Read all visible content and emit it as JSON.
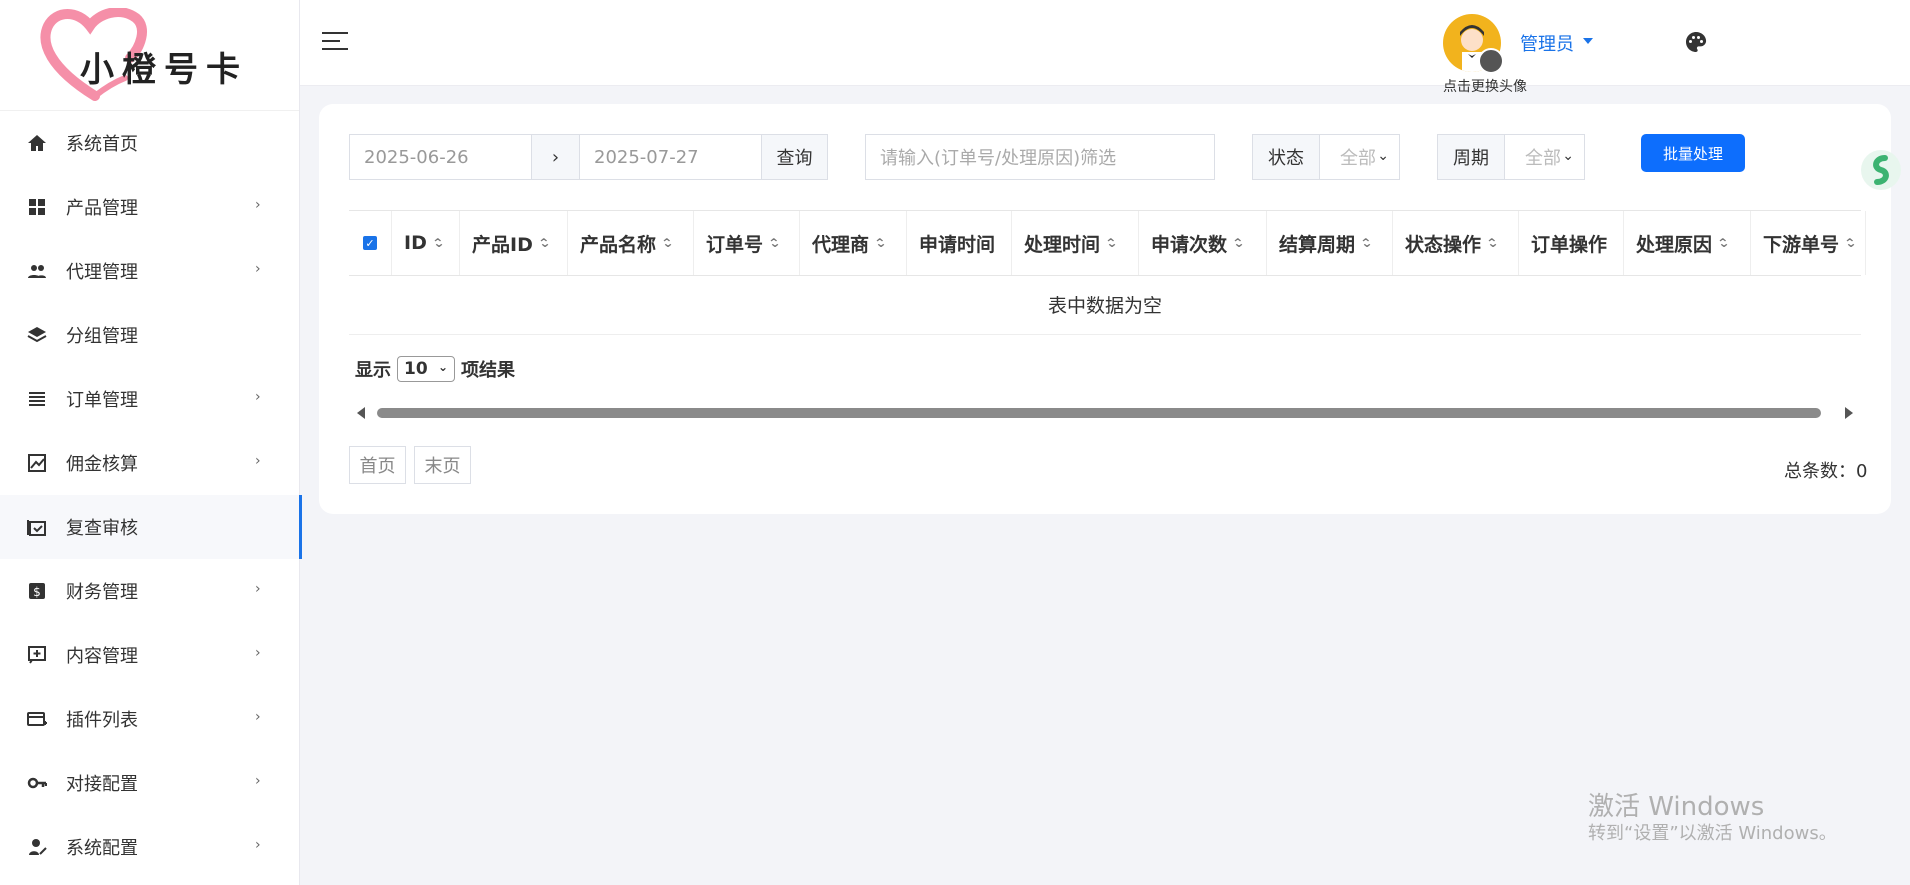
{
  "brand": {
    "logo_text": "小橙号卡"
  },
  "sidebar": {
    "items": [
      {
        "label": "系统首页",
        "icon": "home-icon",
        "has_submenu": false,
        "active": false
      },
      {
        "label": "产品管理",
        "icon": "grid-icon",
        "has_submenu": true,
        "active": false
      },
      {
        "label": "代理管理",
        "icon": "people-icon",
        "has_submenu": true,
        "active": false
      },
      {
        "label": "分组管理",
        "icon": "layers-icon",
        "has_submenu": false,
        "active": false
      },
      {
        "label": "订单管理",
        "icon": "list-icon",
        "has_submenu": true,
        "active": false
      },
      {
        "label": "佣金核算",
        "icon": "chart-icon",
        "has_submenu": true,
        "active": false
      },
      {
        "label": "复查审核",
        "icon": "review-icon",
        "has_submenu": false,
        "active": true
      },
      {
        "label": "财务管理",
        "icon": "dollar-icon",
        "has_submenu": true,
        "active": false
      },
      {
        "label": "内容管理",
        "icon": "content-icon",
        "has_submenu": true,
        "active": false
      },
      {
        "label": "插件列表",
        "icon": "card-icon",
        "has_submenu": true,
        "active": false
      },
      {
        "label": "对接配置",
        "icon": "key-icon",
        "has_submenu": true,
        "active": false
      },
      {
        "label": "系统配置",
        "icon": "user-settings-icon",
        "has_submenu": true,
        "active": false
      }
    ],
    "chevron": "›"
  },
  "header": {
    "avatar_hint": "点击更换头像",
    "user_label": "管理员"
  },
  "filters": {
    "start_date": "2025-06-26",
    "range_separator": "›",
    "end_date": "2025-07-27",
    "query_button": "查询",
    "search_placeholder": "请输入(订单号/处理原因)筛选",
    "status_label": "状态",
    "status_value": "全部",
    "period_label": "周期",
    "period_value": "全部",
    "batch_button": "批量处理"
  },
  "table": {
    "columns": [
      "ID",
      "产品ID",
      "产品名称",
      "订单号",
      "代理商",
      "申请时间",
      "处理时间",
      "申请次数",
      "结算周期",
      "状态操作",
      "订单操作",
      "处理原因",
      "下游单号"
    ],
    "empty_text": "表中数据为空",
    "select_all_checked": true
  },
  "length": {
    "prefix": "显示",
    "value": "10",
    "suffix": "项结果"
  },
  "pagination": {
    "first": "首页",
    "last": "末页",
    "total_text": "总条数：0"
  },
  "watermark": {
    "line1": "激活 Windows",
    "line2": "转到“设置”以激活 Windows。"
  },
  "colors": {
    "accent": "#1a73e8",
    "primary_button": "#0d6efd",
    "background": "#f3f4f8"
  }
}
